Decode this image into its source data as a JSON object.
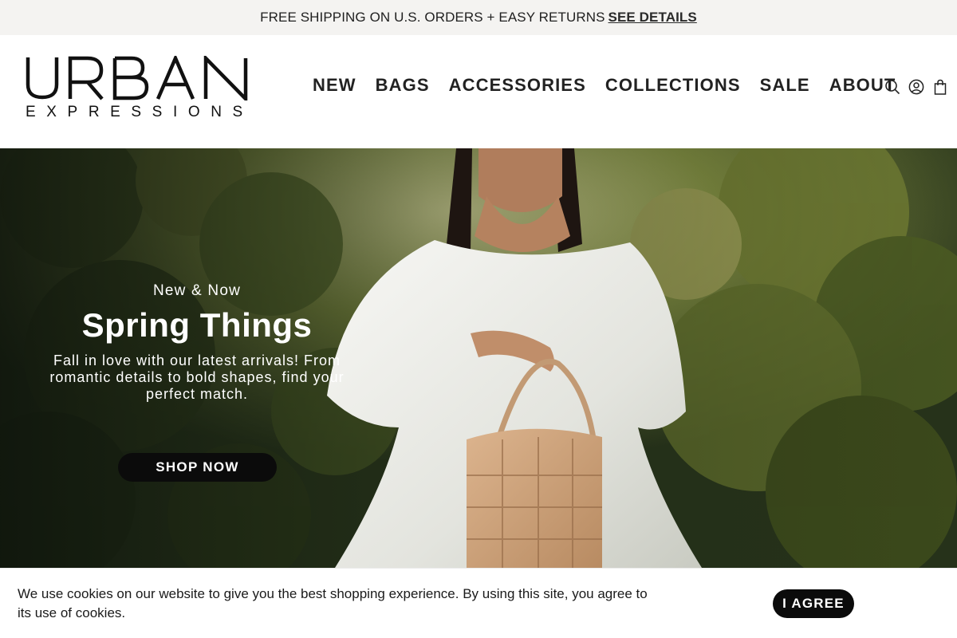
{
  "announcement": {
    "text": "FREE SHIPPING ON U.S. ORDERS + EASY RETURNS",
    "link_label": "SEE DETAILS"
  },
  "brand": {
    "name_main": "URBAN",
    "name_sub": "EXPRESSIONS"
  },
  "nav": {
    "items": [
      "NEW",
      "BAGS",
      "ACCESSORIES",
      "COLLECTIONS",
      "SALE",
      "ABOUT"
    ]
  },
  "header_icons": [
    "search-icon",
    "account-icon",
    "cart-icon"
  ],
  "hero": {
    "eyebrow": "New & Now",
    "title": "Spring Things",
    "description": "Fall in love with our latest arrivals! From romantic details to bold shapes, find your perfect match.",
    "cta_label": "SHOP NOW"
  },
  "cookie_banner": {
    "text": "We use cookies on our website to give you the best shopping experience. By using this site, you agree to its use of cookies.",
    "accept_label": "I AGREE"
  },
  "colors": {
    "announcement_bg": "#f4f3f1",
    "button_bg": "#0b0b0b",
    "text": "#1a1a1a"
  }
}
